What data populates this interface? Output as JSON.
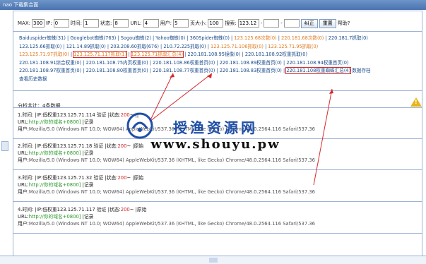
{
  "window": {
    "title": "nao 下载集合面"
  },
  "toolbar": {
    "max_label": "MAX:",
    "max_value": "300",
    "ip_label": "IP:",
    "ip_value": "0",
    "time_label": "时间:",
    "time_value": "1",
    "status_label": "状态:",
    "status_value": "8",
    "url_label": "URL:",
    "url_value": "4",
    "user_label": "用户:",
    "user_value": "5",
    "page_label": "页大小:",
    "page_value": "100",
    "search_label": "搜索:",
    "search_value": "123.12",
    "dash1": "-",
    "dash2": "-",
    "filter_button": "纠正",
    "reset_button": "重置",
    "help": "帮助?"
  },
  "links": {
    "row1": [
      "Baiduspider蜘蛛(31)",
      "Googlebot蜘蛛(763)",
      "Sogou蜘蛛(2)",
      "Yahoo蜘蛛(0)",
      "360Spider蜘蛛(0)",
      "123.125.68次数(0)",
      "220.181.68次数(0)",
      "220.181.7抓取(0)"
    ],
    "row2": [
      "123.125.66抓取(0)",
      "121.14.89抓取(0)",
      "203.208.60抓取(676)",
      "210.72.225抓取(0)",
      "123.125.71.106抓取(0)",
      "123.125.71.95抓取(0)"
    ],
    "row3": [
      "123.125.71.97抓取(0)",
      "123.125.71.117抓取(1)",
      "123.125.71抓取汇总(4)",
      "220.181.108.95镜像(0)",
      "220.181.108.92权重抓取(0)"
    ],
    "row4": [
      "220.181.108.91综合权重(0)",
      "220.181.108.75内页权重(0)",
      "220.181.108.86权重首页(0)",
      "220.181.108.89权重首页(0)",
      "220.181.108.94权重首页(0)"
    ],
    "row5": [
      "220.181.108.97权重首页(0)",
      "220.181.108.80权重首页(0)",
      "220.181.108.77权重首页(0)",
      "220.181.108.83权重首页(0)",
      "220.181.108权重蜘蛛汇总(4)",
      "数据存档"
    ],
    "row6": [
      "查看历史数据"
    ]
  },
  "summary": "分析共计：4条数据",
  "watermark": {
    "cn": "授渔资源网",
    "url": "www.shouyu.pw"
  },
  "entries": [
    {
      "head": "1.时间:",
      "ip": "|IP:低权重123.125.71.114",
      "verify": "验证 |状态:",
      "status": "200",
      "tail": "||",
      "url_label": "URL:",
      "url": "http://你的域名+0800]",
      "record": "记录",
      "ua_label": "用户:",
      "ua": "Mozilla/5.0 (Windows NT 10.0; WOW64) AppleWebKit/537.36 (KHTML, like Gecko) Chrome/48.0.2564.116 Safari/537.36"
    },
    {
      "head": "2.时间:",
      "ip": "|IP:低权重123.125.71.18",
      "verify": "验证 |状态:",
      "status": "200",
      "tail": "|原始",
      "url_label": "URL:",
      "url": "http://你的域名+0800]",
      "record": "记录",
      "ua_label": "用户:",
      "ua": "Mozilla/5.0 (Windows NT 10.0; WOW64) AppleWebKit/537.36 (KHTML, like Gecko) Chrome/48.0.2564.116 Safari/537.36"
    },
    {
      "head": "3.时间:",
      "ip": "|IP:低权重123.125.71.32",
      "verify": "验证 |状态:",
      "status": "200",
      "tail": "|原始",
      "url_label": "URL:",
      "url": "http://你的域名+0800]",
      "record": "记录",
      "ua_label": "用户:",
      "ua": "Mozilla/5.0 (Windows NT 10.0; WOW64) AppleWebKit/537.36 (KHTML, like Gecko) Chrome/48.0.2564.116 Safari/537.36"
    },
    {
      "head": "4.时间:",
      "ip": "|IP:低权重123.125.71.117",
      "verify": "验证 |状态:",
      "status": "200",
      "tail": "|原始",
      "url_label": "URL:",
      "url": "http://你的域名+0800]",
      "record": "记录",
      "ua_label": "用户:",
      "ua": "Mozilla/5.0 (Windows NT 10.0; WOW64) AppleWebKit/537.36 (KHTML, like Gecko) Chrome/48.0.2564.116 Safari/537.36"
    }
  ]
}
